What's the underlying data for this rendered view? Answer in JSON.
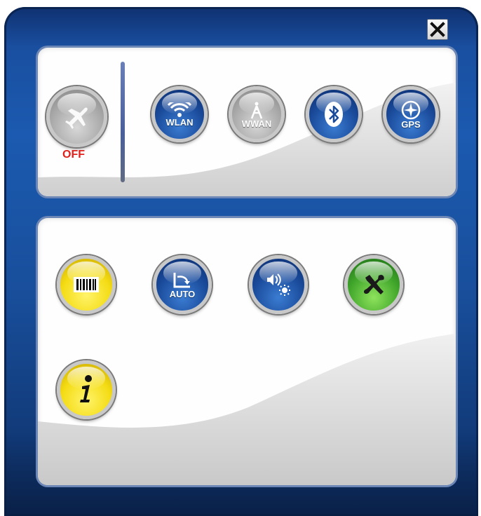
{
  "window": {
    "close_icon": "close-icon"
  },
  "airplane": {
    "icon": "airplane-icon",
    "state_label": "OFF",
    "state_color": "#e0211b"
  },
  "radios": {
    "wlan": {
      "label": "WLAN",
      "icon": "wifi-icon"
    },
    "wwan": {
      "label": "WWAN",
      "icon": "antenna-icon"
    },
    "bluetooth": {
      "icon": "bluetooth-icon"
    },
    "gps": {
      "label": "GPS",
      "icon": "compass-icon"
    }
  },
  "tools": {
    "barcode": {
      "icon": "barcode-icon"
    },
    "auto_rotate": {
      "label": "AUTO",
      "icon": "rotate-icon"
    },
    "volume_brightness": {
      "icon": "volume-brightness-icon"
    },
    "settings": {
      "icon": "tools-icon"
    },
    "info": {
      "icon": "info-icon"
    }
  },
  "colors": {
    "frame_blue": "#1b5ab0",
    "button_blue": "#1a4a9a",
    "button_yellow": "#f4dc14",
    "button_green": "#3fa52a",
    "off_red": "#e0211b"
  }
}
